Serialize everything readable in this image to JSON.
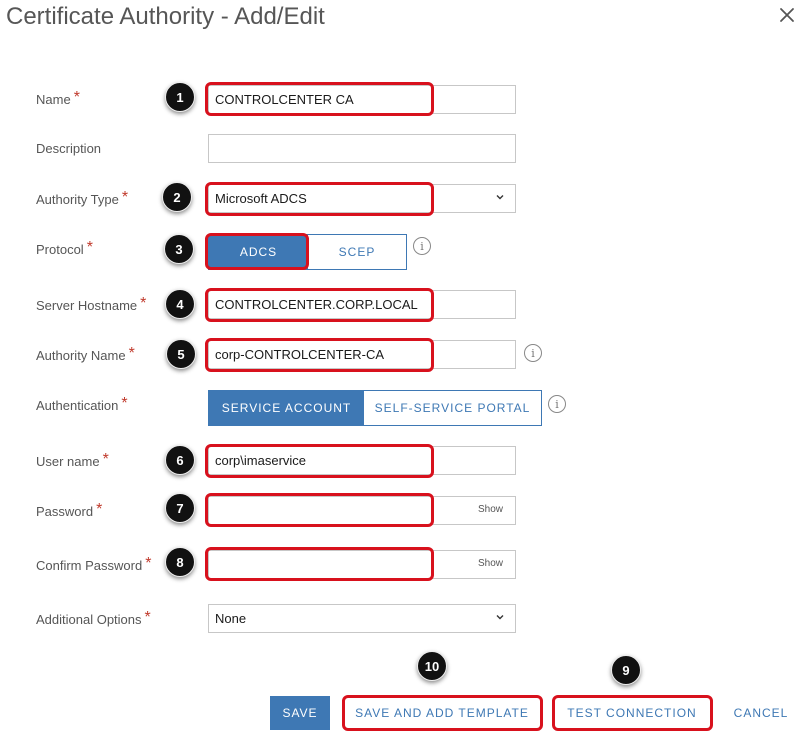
{
  "dialog": {
    "title": "Certificate Authority - Add/Edit",
    "close_icon": "close-icon"
  },
  "colors": {
    "accent": "#3e78b4",
    "highlight": "#d8111d",
    "required": "#c0392b"
  },
  "form": {
    "required_mark": "*",
    "name": {
      "label": "Name",
      "value": "CONTROLCENTER CA"
    },
    "description": {
      "label": "Description",
      "value": ""
    },
    "authority_type": {
      "label": "Authority Type",
      "value": "Microsoft ADCS"
    },
    "protocol": {
      "label": "Protocol",
      "options": [
        "ADCS",
        "SCEP"
      ],
      "selected": "ADCS"
    },
    "server_hostname": {
      "label": "Server Hostname",
      "value": "CONTROLCENTER.CORP.LOCAL"
    },
    "authority_name": {
      "label": "Authority Name",
      "value": "corp-CONTROLCENTER-CA"
    },
    "authentication": {
      "label": "Authentication",
      "options": [
        "SERVICE ACCOUNT",
        "SELF-SERVICE PORTAL"
      ],
      "selected": "SERVICE ACCOUNT"
    },
    "user_name": {
      "label": "User name",
      "value": "corp\\imaservice"
    },
    "password": {
      "label": "Password",
      "value": "",
      "show_label": "Show"
    },
    "confirm_password": {
      "label": "Confirm Password",
      "value": "",
      "show_label": "Show"
    },
    "additional_options": {
      "label": "Additional Options",
      "value": "None"
    },
    "info_glyph": "i"
  },
  "annotations": [
    "1",
    "2",
    "3",
    "4",
    "5",
    "6",
    "7",
    "8",
    "9",
    "10"
  ],
  "footer": {
    "save": "SAVE",
    "save_and_add_template": "SAVE AND ADD TEMPLATE",
    "test_connection": "TEST CONNECTION",
    "cancel": "CANCEL"
  }
}
